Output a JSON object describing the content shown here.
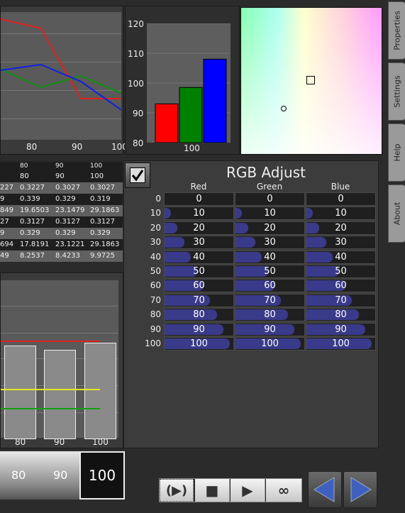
{
  "line_chart": {
    "x_ticks": [
      "80",
      "90",
      "100"
    ],
    "series": [
      {
        "color": "#e02020",
        "values": [
          null,
          1,
          0.92,
          0.3,
          0.3
        ]
      },
      {
        "color": "#109010",
        "values": [
          null,
          0.56,
          0.4,
          0.5,
          0.35
        ]
      },
      {
        "color": "#1020e0",
        "values": [
          null,
          0.55,
          0.6,
          0.45,
          0.2
        ]
      }
    ]
  },
  "bar_chart": {
    "chart_data": {
      "type": "bar",
      "categories": [
        "100"
      ],
      "series": [
        {
          "color": "#ff0000",
          "values": [
            93
          ]
        },
        {
          "color": "#008000",
          "values": [
            98.5
          ]
        },
        {
          "color": "#0000ff",
          "values": [
            108
          ]
        }
      ],
      "ylim": [
        80,
        120
      ],
      "yticks": [
        "120",
        "110",
        "100",
        "90",
        "80"
      ]
    }
  },
  "table": {
    "header": [
      "80",
      "90",
      "100"
    ],
    "rows": [
      [
        "",
        "80",
        "90",
        "100"
      ],
      [
        "227",
        "0.3227",
        "0.3027",
        "0.3027"
      ],
      [
        "9",
        "0.339",
        "0.329",
        "0.319"
      ],
      [
        "849",
        "19.6503",
        "23.1479",
        "29.1863"
      ],
      [
        "27",
        "0.3127",
        "0.3127",
        "0.3127"
      ],
      [
        "9",
        "0.329",
        "0.329",
        "0.329"
      ],
      [
        "694",
        "17.8191",
        "23.1221",
        "29.1863"
      ],
      [
        "49",
        "8.2537",
        "8.4233",
        "9.9725"
      ]
    ]
  },
  "lower_chart": {
    "x_ticks": [
      "80",
      "90",
      "100"
    ]
  },
  "scrubber": {
    "labels": [
      "80",
      "90"
    ],
    "selected": "100"
  },
  "rgb_adjust": {
    "title": "RGB Adjust",
    "checkbox_checked": true,
    "columns": [
      "Red",
      "Green",
      "Blue"
    ],
    "row_labels": [
      "0",
      "10",
      "20",
      "30",
      "40",
      "50",
      "60",
      "70",
      "80",
      "90",
      "100"
    ],
    "values": [
      "0",
      "10",
      "20",
      "30",
      "40",
      "50",
      "60",
      "70",
      "80",
      "90",
      "100"
    ]
  },
  "tabs": [
    "Properties",
    "Settings",
    "Help",
    "About"
  ],
  "transport": {
    "buttons": [
      "play-loop",
      "stop",
      "play",
      "infinite"
    ],
    "infinite_label": "∞"
  }
}
